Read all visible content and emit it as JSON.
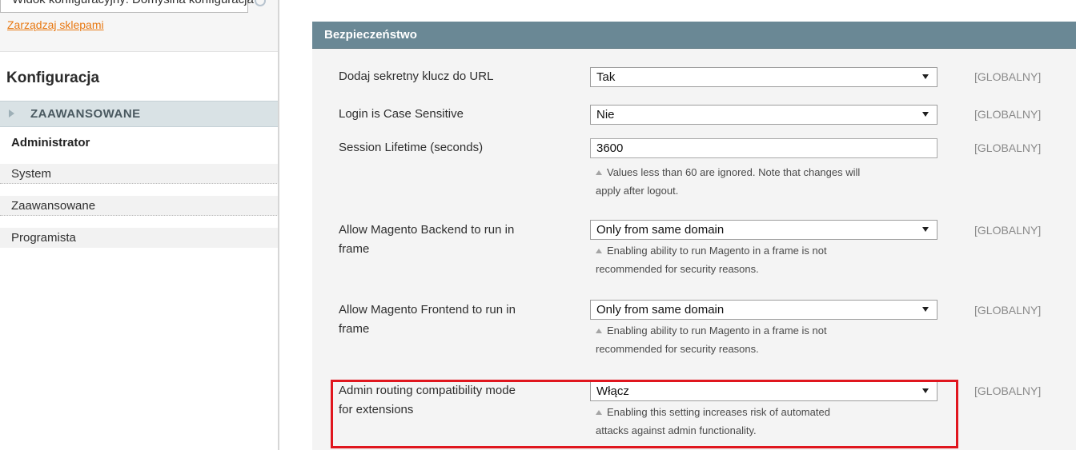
{
  "header_partial": {
    "scope_select_text": "Widok konfiguracyjny: Domyślna konfiguracja",
    "manage_stores_link": "Zarządzaj sklepami"
  },
  "sidebar": {
    "title": "Konfiguracja",
    "section": "ZAAWANSOWANE",
    "items": [
      {
        "label": "Administrator",
        "active": true
      },
      {
        "label": "System",
        "active": false
      },
      {
        "label": "Zaawansowane",
        "active": false
      },
      {
        "label": "Programista",
        "active": false
      }
    ]
  },
  "panel": {
    "title": "Bezpieczeństwo",
    "rows": [
      {
        "label": "Dodaj sekretny klucz do URL",
        "control": "select",
        "value": "Tak",
        "scope": "[GLOBALNY]"
      },
      {
        "label": "Login is Case Sensitive",
        "control": "select",
        "value": "Nie",
        "scope": "[GLOBALNY]"
      },
      {
        "label": "Session Lifetime (seconds)",
        "control": "input",
        "value": "3600",
        "note_line1": "Values less than 60 are ignored. Note that changes will",
        "note_line2": "apply after logout.",
        "scope": "[GLOBALNY]"
      },
      {
        "label_line1": "Allow Magento Backend to run in",
        "label_line2": "frame",
        "control": "select",
        "value": "Only from same domain",
        "note_line1": "Enabling ability to run Magento in a frame is not",
        "note_line2": "recommended for security reasons.",
        "scope": "[GLOBALNY]"
      },
      {
        "label_line1": "Allow Magento Frontend to run in",
        "label_line2": "frame",
        "control": "select",
        "value": "Only from same domain",
        "note_line1": "Enabling ability to run Magento in a frame is not",
        "note_line2": "recommended for security reasons.",
        "scope": "[GLOBALNY]"
      },
      {
        "label_line1": "Admin routing compatibility mode",
        "label_line2": "for extensions",
        "control": "select",
        "value": "Włącz",
        "note_line1": "Enabling this setting increases risk of automated",
        "note_line2": "attacks against admin functionality.",
        "scope": "[GLOBALNY]",
        "highlighted": true
      }
    ]
  },
  "colors": {
    "panel_header": "#6a8895",
    "highlight": "#e0161e",
    "link": "#e87811"
  }
}
